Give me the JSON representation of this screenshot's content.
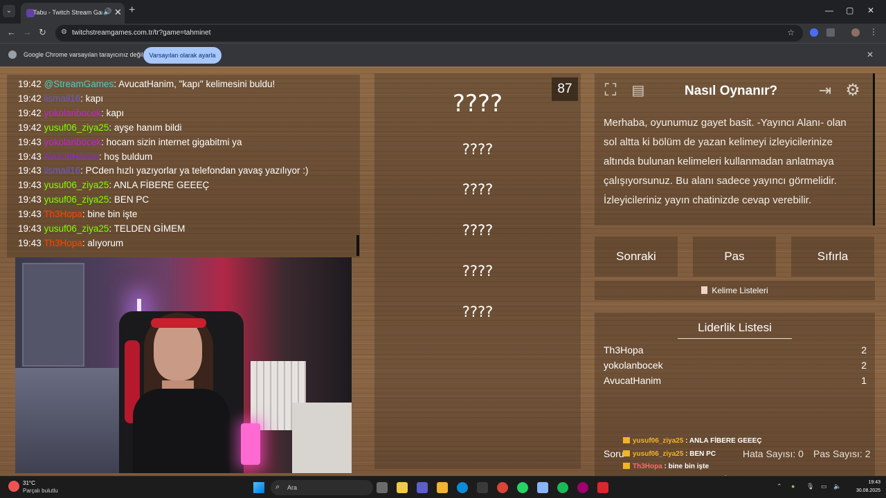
{
  "browser": {
    "tab_title": "Tabu - Twitch Stream Games",
    "tab_close": "✕",
    "new_tab": "+",
    "window_controls": [
      "—",
      "▢",
      "✕"
    ],
    "nav_back": "←",
    "nav_forward": "→",
    "nav_reload": "↻",
    "url": "twitchstreamgames.com.tr/tr?game=tahminet",
    "bookmark_star": "☆",
    "infobar_text": "Google Chrome varsayılan tarayıcınız değil",
    "infobar_button": "Varsayılan olarak ayarla",
    "infobar_close": "✕"
  },
  "chat": {
    "lines": [
      {
        "time": "19:42",
        "user": "@StreamGames",
        "sep": ": ",
        "msg": "AvucatHanim, \"kapı\" kelimesini buldu!",
        "color": "#4fd1c5"
      },
      {
        "time": "19:42",
        "user": "iismail16",
        "sep": ": ",
        "msg": "kapı",
        "color": "#6a5acd"
      },
      {
        "time": "19:42",
        "user": "yokolanbocek",
        "sep": ": ",
        "msg": "kapı",
        "color": "#c026d3"
      },
      {
        "time": "19:42",
        "user": "yusuf06_ziya25",
        "sep": ": ",
        "msg": "ayşe hanım bildi",
        "color": "#7fff00"
      },
      {
        "time": "19:43",
        "user": "yokolanbocek",
        "sep": ": ",
        "msg": "hocam sizin internet gigabitmi ya",
        "color": "#c026d3"
      },
      {
        "time": "19:43",
        "user": "AvucatHanim",
        "sep": ": ",
        "msg": "hoş buldum",
        "color": "#8a2be2"
      },
      {
        "time": "19:43",
        "user": "iismail16",
        "sep": ": ",
        "msg": "PCden hızlı yazıyorlar ya telefondan yavaş yazılıyor :)",
        "color": "#6a5acd"
      },
      {
        "time": "19:43",
        "user": "yusuf06_ziya25",
        "sep": ": ",
        "msg": "ANLA FİBERE GEEEÇ",
        "color": "#7fff00"
      },
      {
        "time": "19:43",
        "user": "yusuf06_ziya25",
        "sep": ": ",
        "msg": "BEN PC",
        "color": "#7fff00"
      },
      {
        "time": "19:43",
        "user": "Th3Hopa",
        "sep": ": ",
        "msg": "bine bin işte",
        "color": "#ff4500"
      },
      {
        "time": "19:43",
        "user": "yusuf06_ziya25",
        "sep": ": ",
        "msg": "TELDEN GİMEM",
        "color": "#7fff00"
      },
      {
        "time": "19:43",
        "user": "Th3Hopa",
        "sep": ": ",
        "msg": "alıyorum",
        "color": "#ff4500"
      }
    ]
  },
  "game": {
    "timer": "87",
    "main_word": "????",
    "taboo_words": [
      "????",
      "????",
      "????",
      "????",
      "????"
    ]
  },
  "help": {
    "title": "Nasıl Oynanır?",
    "text": "Merhaba, oyunumuz gayet basit. -Yayıncı Alanı- olan sol altta ki bölüm de yazan kelimeyi izleyicilerinize altında bulunan kelimeleri kullanmadan anlatmaya çalışıyorsunuz. Bu alanı sadece yayıncı görmelidir. İzleyicileriniz yayın chatinizde cevap verebilir."
  },
  "controls": {
    "next": "Sonraki",
    "pass": "Pas",
    "reset": "Sıfırla",
    "word_lists": "Kelime Listeleri"
  },
  "leaderboard": {
    "title": "Liderlik Listesi",
    "rows": [
      {
        "name": "Th3Hopa",
        "score": "2"
      },
      {
        "name": "yokolanbocek",
        "score": "2"
      },
      {
        "name": "AvucatHanim",
        "score": "1"
      }
    ],
    "footer_label": "Soru",
    "errors": "Hata Sayısı: 0",
    "passes": "Pas Sayısı: 2"
  },
  "overlay": [
    {
      "user": "yusuf06_ziya25",
      "msg": " : ANLA FİBERE GEEEÇ",
      "color": "#f0b429"
    },
    {
      "user": "yusuf06_ziya25",
      "msg": " : BEN PC",
      "color": "#f0b429"
    },
    {
      "user": "Th3Hopa",
      "msg": " : bine bin işte",
      "color": "#ff6b6b"
    },
    {
      "user": "yusuf06_ziya25",
      "msg": " : TELDEN GİMEM",
      "color": "#f0b429"
    },
    {
      "user": "",
      "msg": "alıyorum",
      "color": "#ffffff"
    }
  ],
  "taskbar": {
    "temp": "31°C",
    "condition": "Parçalı bulutlu",
    "search": "Ara",
    "time": "19:43",
    "date": "30.08.2025"
  }
}
